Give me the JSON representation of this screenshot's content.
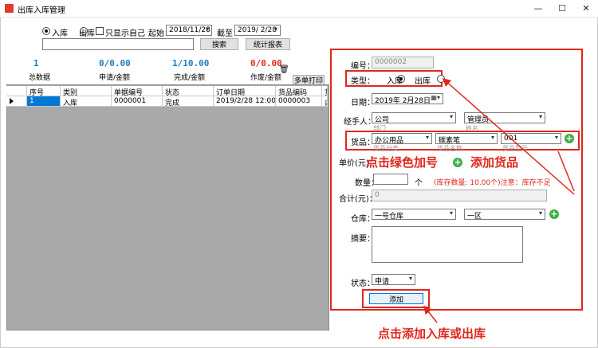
{
  "window": {
    "title": "出库入库管理",
    "minimize": "—",
    "maximize": "☐",
    "close": "✕"
  },
  "filter": {
    "radio_in": "入库",
    "radio_out": "出库",
    "check_self": "只显示自己",
    "start_label": "起始：",
    "start_value": "2018/11/28",
    "end_label": "截至：",
    "end_value": "2019/ 2/28",
    "search_value": "",
    "search_button": "搜索",
    "report_button": "统计报表"
  },
  "stats": [
    {
      "value": "1",
      "label": "总数据",
      "color": "#1e7bbf"
    },
    {
      "value": "0/0.00",
      "label": "申请/金额",
      "color": "#1e7bbf"
    },
    {
      "value": "1/10.00",
      "label": "完成/金额",
      "color": "#1e7bbf"
    },
    {
      "value": "0/0.00",
      "label": "作废/金额",
      "color": "#e0271c"
    }
  ],
  "print_button": "多单打印",
  "table": {
    "columns": [
      "序号",
      "类别",
      "单据编号",
      "状态",
      "订单日期",
      "货品编码",
      "货"
    ],
    "rows": [
      [
        "1",
        "入库",
        "0000001",
        "完成",
        "2019/2/28 12:00:00",
        "0000003",
        "办"
      ]
    ]
  },
  "form": {
    "code_label": "编号：",
    "code_value": "0000002",
    "type_label": "类型：",
    "type_in": "入库",
    "type_out": "出库",
    "date_label": "日期：",
    "date_value": "2019年 2月28日",
    "handler_label": "经手人：",
    "dept_value": "公司",
    "person_value": "管理员",
    "dept_hint": "部门",
    "person_hint": "姓名",
    "goods_label": "货品：",
    "goods_category": "办公用品",
    "goods_name": "碳素笔",
    "goods_model": "001",
    "goods_category_hint": "货品分类",
    "goods_name_hint": "货品名称",
    "goods_model_hint": "货品型号",
    "price_label": "单价(元)：",
    "qty_label": "数量：",
    "qty_value": "",
    "qty_unit": "个",
    "qty_note": "(库存数量: 10.00个)注意：库存不足",
    "total_label": "合计(元)：",
    "total_value": "0",
    "warehouse_label": "仓库：",
    "warehouse_value": "一号仓库",
    "area_value": "一区",
    "remark_label": "摘要：",
    "remark_value": "",
    "status_label": "状态：",
    "status_value": "申请",
    "add_button": "添加"
  },
  "annotations": {
    "click_green_plus": "点击绿色加号",
    "add_goods": "添加货品",
    "click_add": "点击添加入库或出库"
  },
  "colors": {
    "accent_red": "#e0271c",
    "stat_blue": "#1e7bbf",
    "plus_green": "#3fae46"
  }
}
